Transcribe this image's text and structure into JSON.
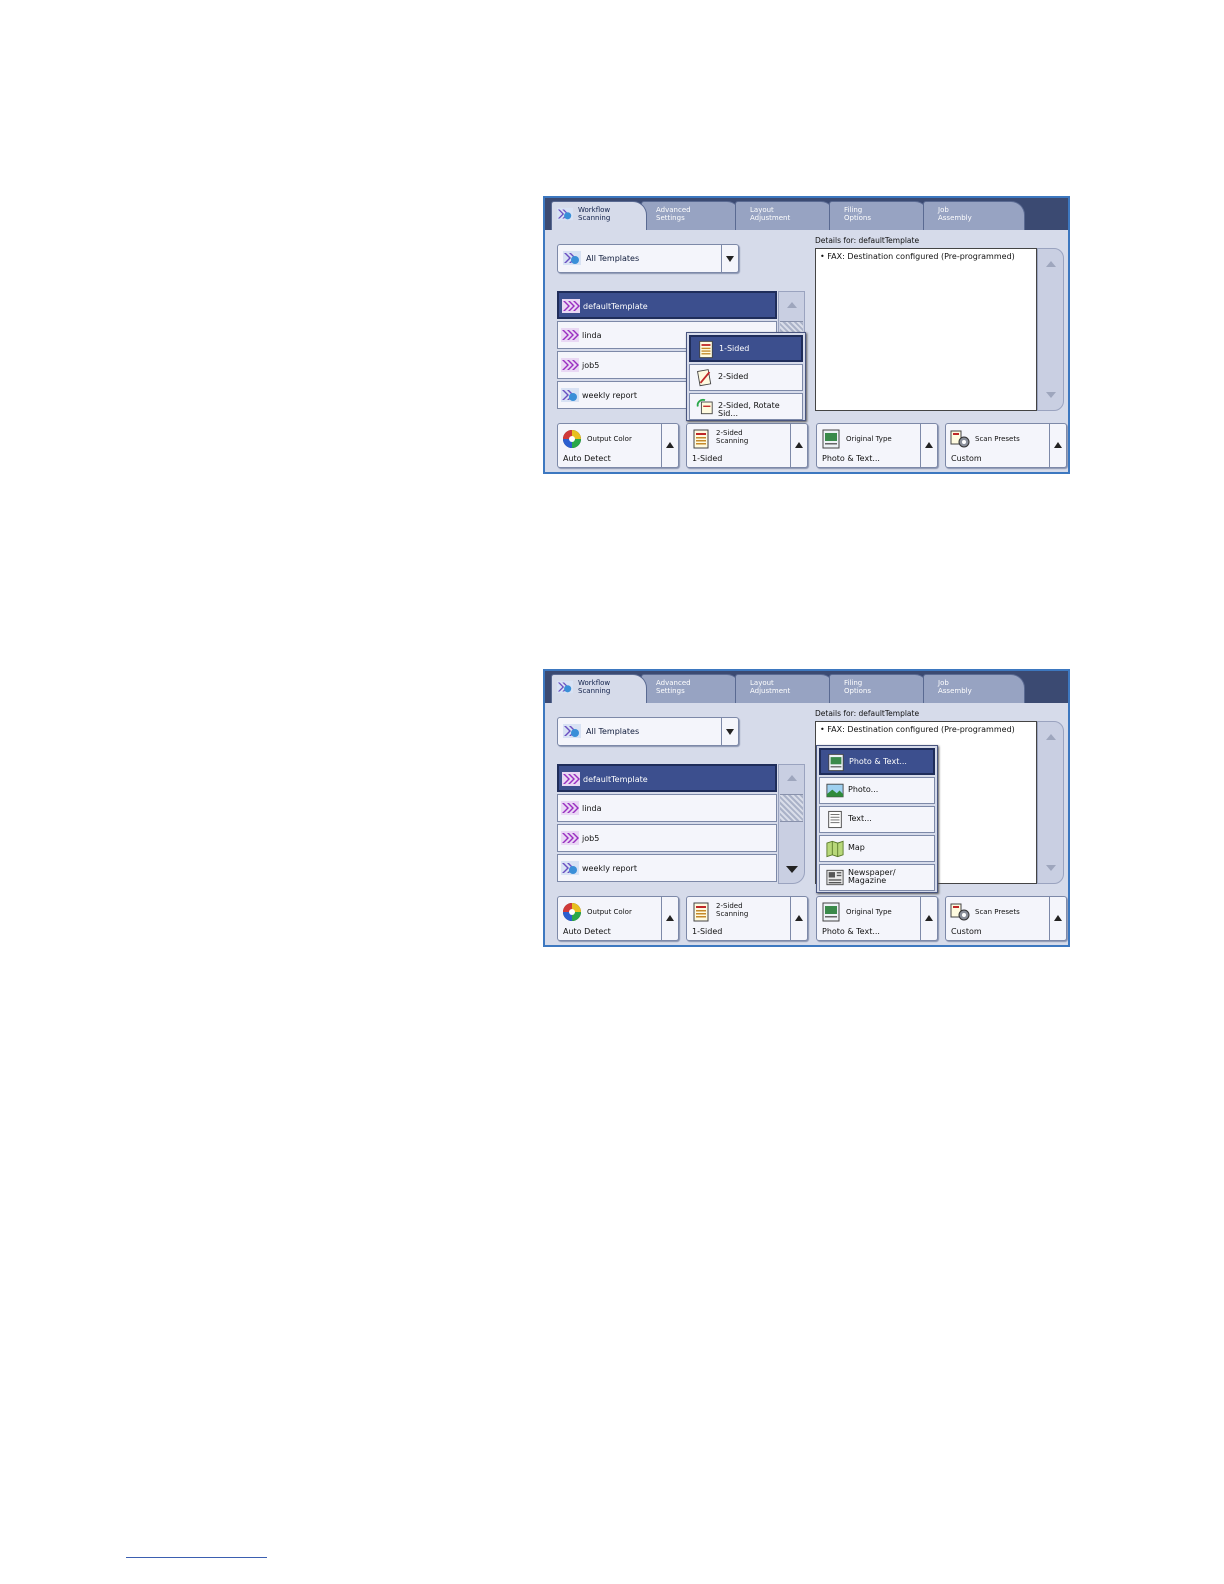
{
  "screens": [
    {
      "tabs": [
        {
          "label": "Workflow\nScanning"
        },
        {
          "label": "Advanced\nSettings"
        },
        {
          "label": "Layout\nAdjustment"
        },
        {
          "label": "Filing\nOptions"
        },
        {
          "label": "Job\nAssembly"
        }
      ],
      "template_dropdown": {
        "label": "All Templates"
      },
      "details": {
        "header": "Details for: defaultTemplate",
        "text": "• FAX: Destination configured  (Pre-programmed)"
      },
      "templates": [
        {
          "label": "defaultTemplate",
          "selected": true
        },
        {
          "label": "linda"
        },
        {
          "label": "job5"
        },
        {
          "label": "weekly report"
        }
      ],
      "feature_buttons": [
        {
          "title": "Output Color",
          "value": "Auto Detect",
          "icon": "color-wheel-icon"
        },
        {
          "title": "2-Sided\nScanning",
          "value": "1-Sided",
          "icon": "two-sided-icon"
        },
        {
          "title": "Original Type",
          "value": "Photo & Text...",
          "icon": "original-type-icon"
        },
        {
          "title": "Scan Presets",
          "value": "Custom",
          "icon": "scan-presets-icon"
        }
      ],
      "popup": {
        "items": [
          {
            "label": "1-Sided",
            "selected": true,
            "icon": "one-sided-icon"
          },
          {
            "label": "2-Sided",
            "icon": "two-sided-page-icon"
          },
          {
            "label": "2-Sided, Rotate Sid...",
            "icon": "two-sided-rotate-icon"
          }
        ]
      }
    },
    {
      "tabs": [
        {
          "label": "Workflow\nScanning"
        },
        {
          "label": "Advanced\nSettings"
        },
        {
          "label": "Layout\nAdjustment"
        },
        {
          "label": "Filing\nOptions"
        },
        {
          "label": "Job\nAssembly"
        }
      ],
      "template_dropdown": {
        "label": "All Templates"
      },
      "details": {
        "header": "Details for: defaultTemplate",
        "text": "• FAX: Destination configured  (Pre-programmed)"
      },
      "templates": [
        {
          "label": "defaultTemplate",
          "selected": true
        },
        {
          "label": "linda"
        },
        {
          "label": "job5"
        },
        {
          "label": "weekly report"
        }
      ],
      "feature_buttons": [
        {
          "title": "Output Color",
          "value": "Auto Detect",
          "icon": "color-wheel-icon"
        },
        {
          "title": "2-Sided\nScanning",
          "value": "1-Sided",
          "icon": "two-sided-icon"
        },
        {
          "title": "Original Type",
          "value": "Photo & Text...",
          "icon": "original-type-icon"
        },
        {
          "title": "Scan Presets",
          "value": "Custom",
          "icon": "scan-presets-icon"
        }
      ],
      "popup": {
        "items": [
          {
            "label": "Photo & Text...",
            "selected": true,
            "icon": "photo-text-icon"
          },
          {
            "label": "Photo...",
            "icon": "photo-icon"
          },
          {
            "label": "Text...",
            "icon": "text-icon"
          },
          {
            "label": "Map",
            "icon": "map-icon"
          },
          {
            "label": "Newspaper/\nMagazine",
            "icon": "newspaper-icon"
          }
        ]
      }
    }
  ],
  "colors": {
    "accent": "#3c4f8e",
    "tabbar": "#3b4a72",
    "panel": "#d6dbea",
    "frame": "#3d78c0"
  }
}
